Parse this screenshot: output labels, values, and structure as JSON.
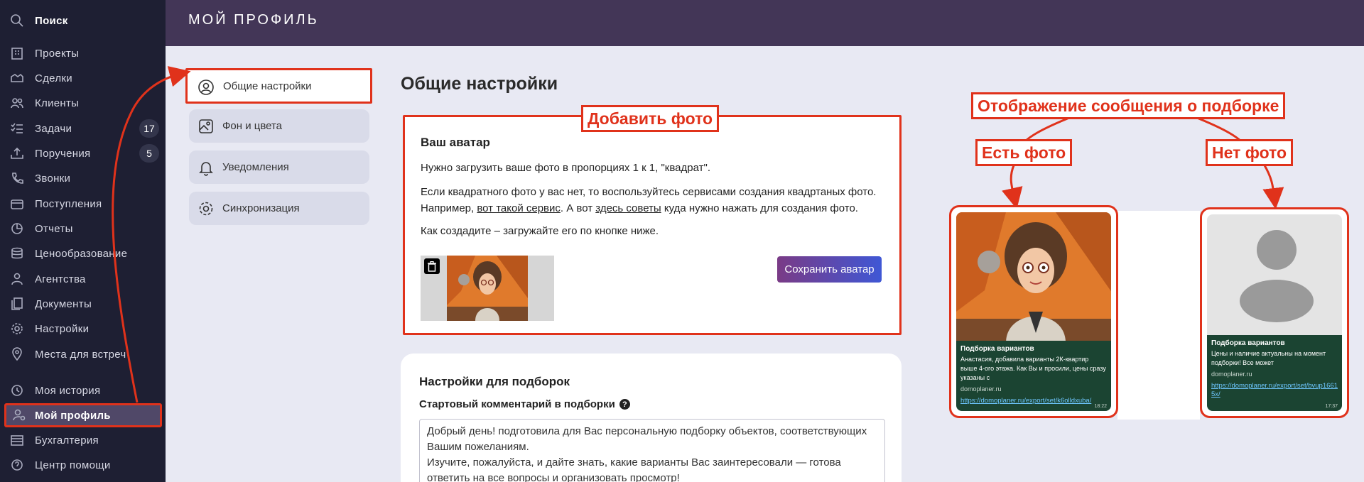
{
  "sidebar": {
    "search": "Поиск",
    "items": [
      {
        "label": "Проекты",
        "icon": "building-icon"
      },
      {
        "label": "Сделки",
        "icon": "handshake-icon"
      },
      {
        "label": "Клиенты",
        "icon": "users-icon"
      },
      {
        "label": "Задачи",
        "icon": "checklist-icon",
        "badge": "17"
      },
      {
        "label": "Поручения",
        "icon": "upload-tray-icon",
        "badge": "5"
      },
      {
        "label": "Звонки",
        "icon": "phone-icon"
      },
      {
        "label": "Поступления",
        "icon": "wallet-icon"
      },
      {
        "label": "Отчеты",
        "icon": "pie-chart-icon"
      },
      {
        "label": "Ценообразование",
        "icon": "coins-icon"
      },
      {
        "label": "Агентства",
        "icon": "agent-icon"
      },
      {
        "label": "Документы",
        "icon": "documents-icon"
      },
      {
        "label": "Настройки",
        "icon": "gear-icon"
      },
      {
        "label": "Места для встреч",
        "icon": "map-pin-icon"
      },
      {
        "label": "Моя история",
        "icon": "history-icon"
      },
      {
        "label": "Мой профиль",
        "icon": "user-gear-icon",
        "active": true
      },
      {
        "label": "Бухгалтерия",
        "icon": "ledger-icon"
      },
      {
        "label": "Центр помощи",
        "icon": "help-icon"
      }
    ]
  },
  "header": {
    "title": "МОЙ ПРОФИЛЬ"
  },
  "subnav": {
    "items": [
      {
        "label": "Общие настройки",
        "icon": "user-circle-icon",
        "active": true
      },
      {
        "label": "Фон и цвета",
        "icon": "image-icon"
      },
      {
        "label": "Уведомления",
        "icon": "bell-icon"
      },
      {
        "label": "Синхронизация",
        "icon": "gear-icon"
      }
    ]
  },
  "main": {
    "title": "Общие настройки",
    "avatar_card": {
      "heading": "Ваш аватар",
      "p1": "Нужно загрузить ваше фото в пропорциях 1 к 1, \"квадрат\".",
      "p2_a": "Если квадратного фото у вас нет, то воспользуйтесь сервисами создания квадртаных фото.",
      "p2_b": "Например, ",
      "p2_link1": "вот такой сервис",
      "p2_c": ". А вот ",
      "p2_link2": "здесь советы",
      "p2_d": " куда нужно нажать для создания фото.",
      "p3": "Как создадите – загружайте его по кнопке ниже.",
      "save_button": "Сохранить аватар"
    },
    "selection_card": {
      "heading": "Настройки для подборок",
      "field_label": "Стартовый комментарий в подборки",
      "textarea_value": "Добрый день! подготовила для Вас персональную подборку объектов, соответствующих Вашим пожеланиям.\nИзучите, пожалуйста, и дайте знать, какие варианты Вас заинтересовали — готова ответить на все вопросы и организовать просмотр!"
    }
  },
  "annotations": {
    "add_photo": "Добавить фото",
    "display_title": "Отображение сообщения о подборке",
    "with_photo": "Есть фото",
    "no_photo": "Нет фото"
  },
  "previews": {
    "with_photo": {
      "title": "Подборка вариантов",
      "body": "Анастасия, добавила варианты 2К-квартир выше 4-ого этажа. Как Вы и просили, цены сразу указаны с",
      "site": "domoplaner.ru",
      "link": "https://domoplaner.ru/export/set/k6olldxuba/",
      "time": "18:22"
    },
    "no_photo": {
      "title": "Подборка вариантов",
      "body": "Цены и наличие актуальны на момент подборки! Все может",
      "site": "domoplaner.ru",
      "link": "https://domoplaner.ru/export/set/bvup16615x/",
      "time": "17:37"
    }
  },
  "colors": {
    "accent_red": "#e0321b",
    "sidebar_bg": "#1e1f33",
    "header_bg": "#433657",
    "page_bg": "#e8e9f3",
    "message_bg": "#1b4432"
  }
}
